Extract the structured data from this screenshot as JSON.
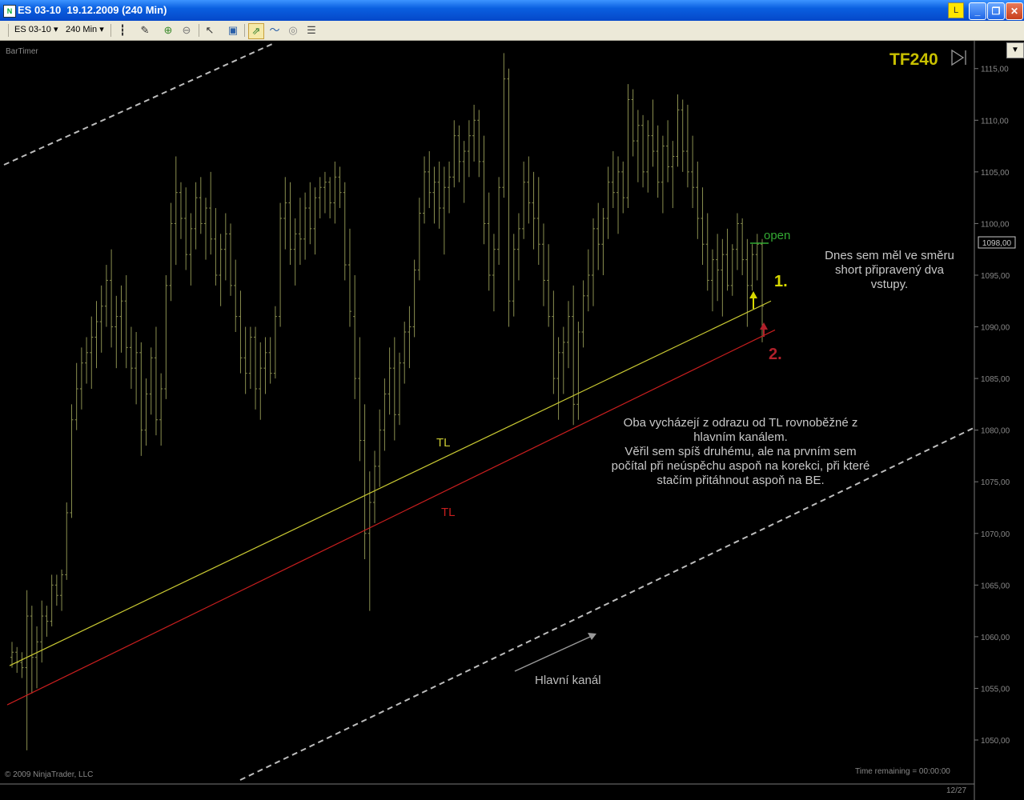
{
  "window": {
    "title": "ES 03-10  19.12.2009 (240 Min)",
    "badge": "L",
    "minimize_glyph": "_",
    "maximize_glyph": "❐",
    "close_glyph": "✕"
  },
  "toolbar": {
    "instrument": "ES 03-10",
    "interval": "240 Min",
    "icons": [
      "bar-type-icon",
      "draw-pen-icon",
      "zoom-in-icon",
      "zoom-out-icon",
      "cursor-icon",
      "data-box-icon",
      "chart-strategy-icon",
      "indicators-icon",
      "globe-icon",
      "properties-icon"
    ]
  },
  "chart": {
    "indicator_label": "BarTimer",
    "timeframe_label": "TF240",
    "copyright": "© 2009 NinjaTrader, LLC",
    "time_remaining": "Time remaining = 00:00:00",
    "date_label": "12/27",
    "current_price": "1098,00",
    "open_label": "open",
    "entry1_label": "1.",
    "entry2_label": "2.",
    "tl_upper_label": "TL",
    "tl_lower_label": "TL",
    "main_channel_label": "Hlavní kanál",
    "note_right": [
      "Dnes sem měl ve směru",
      "short připravený dva",
      "vstupy."
    ],
    "note_center": [
      "Oba vycházejí z odrazu od TL rovnoběžné z",
      "hlavním kanálem.",
      "Věřil sem spíš druhému, ale na prvním sem",
      "počítal při neúspěchu aspoň na korekci, při které",
      "stačím přitáhnout aspoň na BE."
    ],
    "price_ticks": [
      "1115,00",
      "1110,00",
      "1105,00",
      "1100,00",
      "1095,00",
      "1090,00",
      "1085,00",
      "1080,00",
      "1075,00",
      "1070,00",
      "1065,00",
      "1060,00",
      "1055,00",
      "1050,00"
    ],
    "colors": {
      "background": "#000000",
      "bars": "#8a8f50",
      "tl_upper": "#c8c832",
      "tl_lower": "#c81e1e",
      "channel": "#bdbdbd",
      "tf_label": "#c8c000",
      "open_line": "#33aa33",
      "entry2": "#b0202a",
      "note_text": "#c8c8c8"
    }
  },
  "chart_data": {
    "type": "ohlc",
    "y_range": [
      1047,
      1116.5
    ],
    "bar_count": 160,
    "current_price": 1098.0,
    "trendlines": [
      {
        "label": "TL",
        "from_bar": 0,
        "from_price": 1057.2,
        "to_bar": 159,
        "to_price": 1092.5
      },
      {
        "label": "TL",
        "from_bar": 0,
        "from_price": 1053.4,
        "to_bar": 159,
        "to_price": 1089.7
      }
    ],
    "ohlc": [
      [
        1058.0,
        1059.5,
        1057.0,
        1058.5
      ],
      [
        1058.5,
        1059.0,
        1056.5,
        1057.5
      ],
      [
        1057.5,
        1058.5,
        1056.0,
        1057.0
      ],
      [
        1057.0,
        1064.5,
        1049.0,
        1062.0
      ],
      [
        1062.0,
        1063.0,
        1054.5,
        1058.0
      ],
      [
        1058.0,
        1061.0,
        1055.0,
        1059.5
      ],
      [
        1059.5,
        1063.5,
        1057.5,
        1062.0
      ],
      [
        1062.0,
        1063.0,
        1060.0,
        1061.5
      ],
      [
        1061.5,
        1066.0,
        1061.0,
        1065.0
      ],
      [
        1065.0,
        1066.0,
        1063.0,
        1064.0
      ],
      [
        1064.0,
        1066.5,
        1062.5,
        1066.0
      ],
      [
        1066.0,
        1073.0,
        1065.5,
        1072.0
      ],
      [
        1072.0,
        1082.5,
        1071.5,
        1081.0
      ],
      [
        1081.0,
        1086.5,
        1080.0,
        1084.0
      ],
      [
        1084.0,
        1088.0,
        1082.0,
        1086.5
      ],
      [
        1086.5,
        1089.0,
        1084.5,
        1087.5
      ],
      [
        1087.5,
        1091.0,
        1084.0,
        1089.0
      ],
      [
        1089.0,
        1092.5,
        1086.0,
        1090.5
      ],
      [
        1090.5,
        1094.0,
        1087.5,
        1092.0
      ],
      [
        1092.0,
        1096.0,
        1090.0,
        1094.5
      ],
      [
        1094.5,
        1097.5,
        1088.0,
        1090.0
      ],
      [
        1090.0,
        1093.0,
        1086.0,
        1091.0
      ],
      [
        1091.0,
        1094.0,
        1087.5,
        1092.5
      ],
      [
        1092.5,
        1095.0,
        1086.0,
        1088.0
      ],
      [
        1088.0,
        1090.0,
        1084.0,
        1086.0
      ],
      [
        1086.0,
        1089.5,
        1082.5,
        1087.5
      ],
      [
        1087.5,
        1088.5,
        1077.5,
        1080.0
      ],
      [
        1080.0,
        1085.0,
        1078.5,
        1083.5
      ],
      [
        1083.5,
        1088.0,
        1081.5,
        1087.0
      ],
      [
        1087.0,
        1090.0,
        1079.5,
        1081.0
      ],
      [
        1081.0,
        1085.5,
        1078.5,
        1084.0
      ],
      [
        1084.0,
        1095.0,
        1083.0,
        1094.0
      ],
      [
        1094.0,
        1102.0,
        1092.5,
        1100.0
      ],
      [
        1100.0,
        1106.5,
        1096.0,
        1103.0
      ],
      [
        1103.0,
        1104.0,
        1098.5,
        1100.5
      ],
      [
        1100.5,
        1103.5,
        1095.5,
        1097.0
      ],
      [
        1097.0,
        1101.0,
        1094.0,
        1099.5
      ],
      [
        1099.5,
        1104.0,
        1097.5,
        1102.5
      ],
      [
        1102.5,
        1104.5,
        1099.0,
        1100.0
      ],
      [
        1100.0,
        1102.5,
        1096.5,
        1101.5
      ],
      [
        1101.5,
        1105.0,
        1097.0,
        1098.5
      ],
      [
        1098.5,
        1101.5,
        1094.0,
        1095.0
      ],
      [
        1095.0,
        1099.0,
        1092.0,
        1097.5
      ],
      [
        1097.5,
        1101.0,
        1094.5,
        1099.0
      ],
      [
        1099.0,
        1100.0,
        1093.0,
        1094.0
      ],
      [
        1094.0,
        1096.5,
        1089.5,
        1091.0
      ],
      [
        1091.0,
        1093.5,
        1085.5,
        1087.0
      ],
      [
        1087.0,
        1090.0,
        1083.5,
        1085.5
      ],
      [
        1085.5,
        1090.0,
        1084.0,
        1089.0
      ],
      [
        1089.0,
        1090.0,
        1082.0,
        1084.0
      ],
      [
        1084.0,
        1088.5,
        1081.0,
        1086.0
      ],
      [
        1086.0,
        1089.0,
        1083.5,
        1087.5
      ],
      [
        1087.5,
        1089.0,
        1084.5,
        1085.5
      ],
      [
        1085.5,
        1092.0,
        1085.0,
        1091.0
      ],
      [
        1091.0,
        1102.0,
        1090.0,
        1100.5
      ],
      [
        1100.5,
        1104.5,
        1097.5,
        1102.0
      ],
      [
        1102.0,
        1104.0,
        1096.0,
        1097.5
      ],
      [
        1097.5,
        1100.5,
        1094.0,
        1099.0
      ],
      [
        1099.0,
        1102.5,
        1096.0,
        1098.5
      ],
      [
        1098.5,
        1103.0,
        1096.5,
        1101.5
      ],
      [
        1101.5,
        1104.0,
        1098.0,
        1099.5
      ],
      [
        1099.5,
        1103.5,
        1097.0,
        1102.5
      ],
      [
        1102.5,
        1104.5,
        1100.5,
        1103.5
      ],
      [
        1103.5,
        1105.0,
        1101.0,
        1104.0
      ],
      [
        1104.0,
        1104.5,
        1100.5,
        1102.0
      ],
      [
        1102.0,
        1106.0,
        1100.0,
        1104.5
      ],
      [
        1104.5,
        1105.5,
        1101.5,
        1103.0
      ],
      [
        1103.0,
        1104.0,
        1094.5,
        1096.0
      ],
      [
        1096.0,
        1099.5,
        1090.0,
        1091.5
      ],
      [
        1091.0,
        1095.0,
        1083.0,
        1085.0
      ],
      [
        1085.0,
        1089.0,
        1077.0,
        1079.0
      ],
      [
        1079.0,
        1082.5,
        1067.5,
        1070.0
      ],
      [
        1070.0,
        1076.0,
        1062.5,
        1073.0
      ],
      [
        1073.0,
        1078.0,
        1071.0,
        1076.5
      ],
      [
        1076.5,
        1082.0,
        1074.5,
        1080.0
      ],
      [
        1080.0,
        1085.0,
        1078.0,
        1083.5
      ],
      [
        1083.5,
        1088.0,
        1081.5,
        1086.0
      ],
      [
        1086.0,
        1089.0,
        1079.0,
        1081.5
      ],
      [
        1081.5,
        1087.5,
        1080.5,
        1086.5
      ],
      [
        1086.5,
        1090.5,
        1084.5,
        1089.5
      ],
      [
        1089.5,
        1092.0,
        1086.0,
        1090.0
      ],
      [
        1090.0,
        1096.5,
        1089.0,
        1095.5
      ],
      [
        1095.5,
        1102.5,
        1094.5,
        1101.0
      ],
      [
        1101.0,
        1106.5,
        1100.0,
        1105.0
      ],
      [
        1105.0,
        1107.0,
        1101.5,
        1103.0
      ],
      [
        1103.0,
        1105.5,
        1100.0,
        1104.0
      ],
      [
        1104.0,
        1106.0,
        1099.5,
        1101.5
      ],
      [
        1101.5,
        1105.5,
        1097.0,
        1103.5
      ],
      [
        1103.5,
        1106.0,
        1101.0,
        1104.5
      ],
      [
        1104.5,
        1110.0,
        1103.5,
        1108.5
      ],
      [
        1108.5,
        1109.5,
        1104.0,
        1106.0
      ],
      [
        1106.0,
        1108.0,
        1102.0,
        1107.0
      ],
      [
        1107.0,
        1110.0,
        1104.5,
        1108.5
      ],
      [
        1108.5,
        1111.5,
        1106.0,
        1110.0
      ],
      [
        1110.0,
        1111.0,
        1104.5,
        1106.0
      ],
      [
        1106.0,
        1108.5,
        1098.0,
        1100.0
      ],
      [
        1100.0,
        1103.0,
        1093.5,
        1095.0
      ],
      [
        1095.0,
        1099.0,
        1091.5,
        1097.5
      ],
      [
        1097.5,
        1104.5,
        1096.0,
        1103.5
      ],
      [
        1103.5,
        1116.5,
        1102.5,
        1114.0
      ],
      [
        1114.0,
        1115.0,
        1090.0,
        1092.5
      ],
      [
        1092.5,
        1099.0,
        1091.0,
        1097.5
      ],
      [
        1097.5,
        1101.0,
        1094.5,
        1099.5
      ],
      [
        1099.5,
        1106.0,
        1098.5,
        1104.0
      ],
      [
        1104.0,
        1106.5,
        1100.0,
        1102.0
      ],
      [
        1102.0,
        1105.0,
        1097.5,
        1100.5
      ],
      [
        1100.5,
        1104.5,
        1096.0,
        1098.0
      ],
      [
        1098.0,
        1100.0,
        1092.0,
        1094.5
      ],
      [
        1094.5,
        1098.0,
        1090.0,
        1091.0
      ],
      [
        1091.0,
        1093.5,
        1083.5,
        1085.0
      ],
      [
        1085.0,
        1089.0,
        1081.0,
        1087.5
      ],
      [
        1087.5,
        1090.0,
        1083.5,
        1088.5
      ],
      [
        1088.5,
        1092.5,
        1086.0,
        1091.0
      ],
      [
        1091.0,
        1094.0,
        1080.5,
        1082.5
      ],
      [
        1082.5,
        1090.5,
        1081.0,
        1089.5
      ],
      [
        1089.5,
        1094.5,
        1088.0,
        1093.0
      ],
      [
        1093.0,
        1097.5,
        1091.5,
        1095.0
      ],
      [
        1095.0,
        1100.5,
        1092.0,
        1099.5
      ],
      [
        1099.5,
        1102.0,
        1095.5,
        1098.0
      ],
      [
        1098.0,
        1101.5,
        1095.0,
        1100.5
      ],
      [
        1100.5,
        1105.5,
        1098.5,
        1104.0
      ],
      [
        1104.0,
        1107.0,
        1101.5,
        1103.0
      ],
      [
        1103.0,
        1106.5,
        1099.0,
        1105.0
      ],
      [
        1105.0,
        1106.0,
        1101.0,
        1102.5
      ],
      [
        1102.5,
        1113.5,
        1101.5,
        1112.0
      ],
      [
        1112.0,
        1113.0,
        1106.5,
        1108.0
      ],
      [
        1108.0,
        1111.0,
        1104.0,
        1109.5
      ],
      [
        1109.5,
        1110.5,
        1103.5,
        1105.0
      ],
      [
        1105.0,
        1110.0,
        1103.0,
        1108.5
      ],
      [
        1108.5,
        1112.0,
        1105.5,
        1107.0
      ],
      [
        1107.0,
        1109.5,
        1102.5,
        1104.0
      ],
      [
        1104.0,
        1108.5,
        1101.0,
        1107.5
      ],
      [
        1107.5,
        1110.0,
        1104.0,
        1105.5
      ],
      [
        1105.5,
        1108.0,
        1101.5,
        1106.5
      ],
      [
        1106.5,
        1112.5,
        1105.5,
        1111.0
      ],
      [
        1111.0,
        1112.0,
        1105.0,
        1107.0
      ],
      [
        1107.0,
        1111.5,
        1103.5,
        1105.0
      ],
      [
        1105.0,
        1108.5,
        1101.5,
        1103.5
      ],
      [
        1103.5,
        1106.0,
        1098.5,
        1100.5
      ],
      [
        1100.5,
        1103.5,
        1096.0,
        1098.0
      ],
      [
        1098.0,
        1101.0,
        1093.5,
        1094.5
      ],
      [
        1094.5,
        1097.5,
        1091.5,
        1096.5
      ],
      [
        1096.5,
        1099.0,
        1092.5,
        1095.5
      ],
      [
        1095.5,
        1098.5,
        1091.0,
        1097.0
      ],
      [
        1097.0,
        1099.5,
        1093.5,
        1094.0
      ],
      [
        1094.0,
        1098.0,
        1093.0,
        1097.5
      ],
      [
        1097.5,
        1101.0,
        1095.5,
        1100.0
      ],
      [
        1100.0,
        1100.5,
        1095.0,
        1096.5
      ],
      [
        1096.5,
        1098.5,
        1090.0,
        1094.0
      ],
      [
        1094.0,
        1098.0,
        1093.5,
        1097.0
      ],
      [
        1097.0,
        1099.0,
        1094.5,
        1098.0
      ],
      [
        1098.0,
        1098.5,
        1088.5,
        1092.0
      ]
    ]
  }
}
